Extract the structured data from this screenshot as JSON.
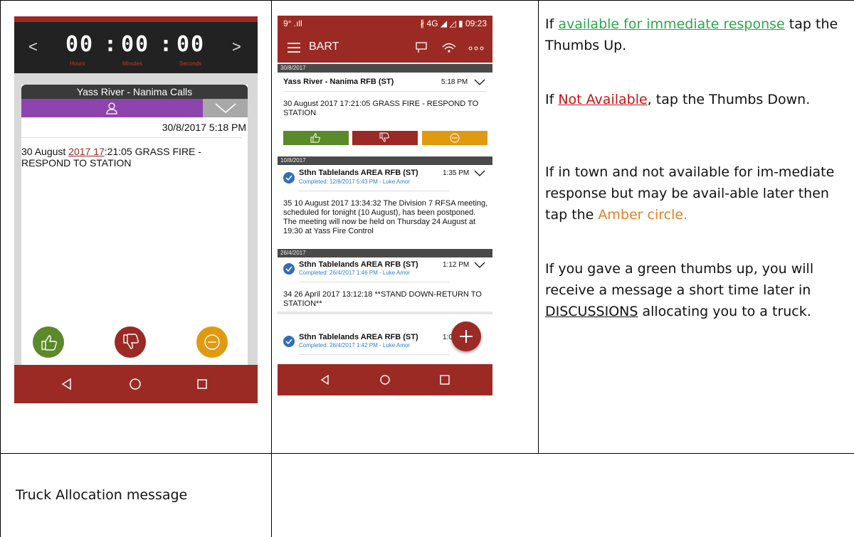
{
  "phone1": {
    "timer": {
      "hours": "00",
      "minutes": "00",
      "seconds": "00",
      "sep": ":",
      "units": [
        "Hours",
        "Minutes",
        "Seconds"
      ]
    },
    "arrows": {
      "left": "<",
      "right": ">"
    },
    "card": {
      "title": "Yass River - Nanima Calls",
      "datetime": "30/8/2017 5:18 PM",
      "message_prefix": "30 August ",
      "message_link": "2017 17",
      "message_suffix": ":21:05 GRASS FIRE - RESPOND TO STATION"
    },
    "buttons": [
      {
        "icon": "thumbs-up-icon",
        "color": "#5a8a2a"
      },
      {
        "icon": "thumbs-down-icon",
        "color": "#9b2a24"
      },
      {
        "icon": "minus-circle-icon",
        "color": "#e09a10"
      }
    ]
  },
  "phone2": {
    "status": {
      "left": "9° .ıll",
      "right": "∦ 4G ◢ ◿ ▮ 09:23"
    },
    "app_title": "BART",
    "items": [
      {
        "date": "30/8/2017",
        "title": "Yass River - Nanima RFB (ST)",
        "time": "5:18 PM",
        "body": "30 August 2017 17:21:05 GRASS FIRE - RESPOND TO STATION"
      },
      {
        "date": "10/8/2017",
        "title": "Sthn Tablelands AREA RFB (ST)",
        "time": "1:35 PM",
        "completed": "Completed: 12/8/2017 5:43 PM - Luke Amor",
        "body": "35 10 August 2017 13:34:32 The Division 7 RFSA meeting, scheduled for tonight (10 August), has been postponed.  The meeting will now be held on Thursday 24 August at 19:30 at Yass Fire Control"
      },
      {
        "date": "26/4/2017",
        "title": "Sthn Tablelands AREA RFB (ST)",
        "time": "1:12 PM",
        "completed": "Completed: 26/4/2017 1:46 PM - Luke Amor",
        "body": "34 26 April 2017 13:12:18 **STAND DOWN-RETURN TO STATION**"
      },
      {
        "title": "Sthn Tablelands AREA RFB (ST)",
        "time": "1:0",
        "completed": "Completed: 26/4/2017 1:42 PM - Luke Amor"
      }
    ]
  },
  "instructions": {
    "p1_a": "If ",
    "p1_link": "available for immediate response",
    "p1_b": " tap the Thumbs Up.",
    "p2_a": "If ",
    "p2_link": "Not Available",
    "p2_b": ", tap the Thumbs Down.",
    "p3_a": "If in town and not available for im-mediate response but may be avail-able later then tap the ",
    "p3_amber": "Amber circle.",
    "p4_a": "If you gave a green thumbs up, you will receive a message a short time later in ",
    "p4_under": "DISCUSSIONS",
    "p4_b": " allocating you to a truck."
  },
  "row2": {
    "label": "Truck Allocation message"
  }
}
